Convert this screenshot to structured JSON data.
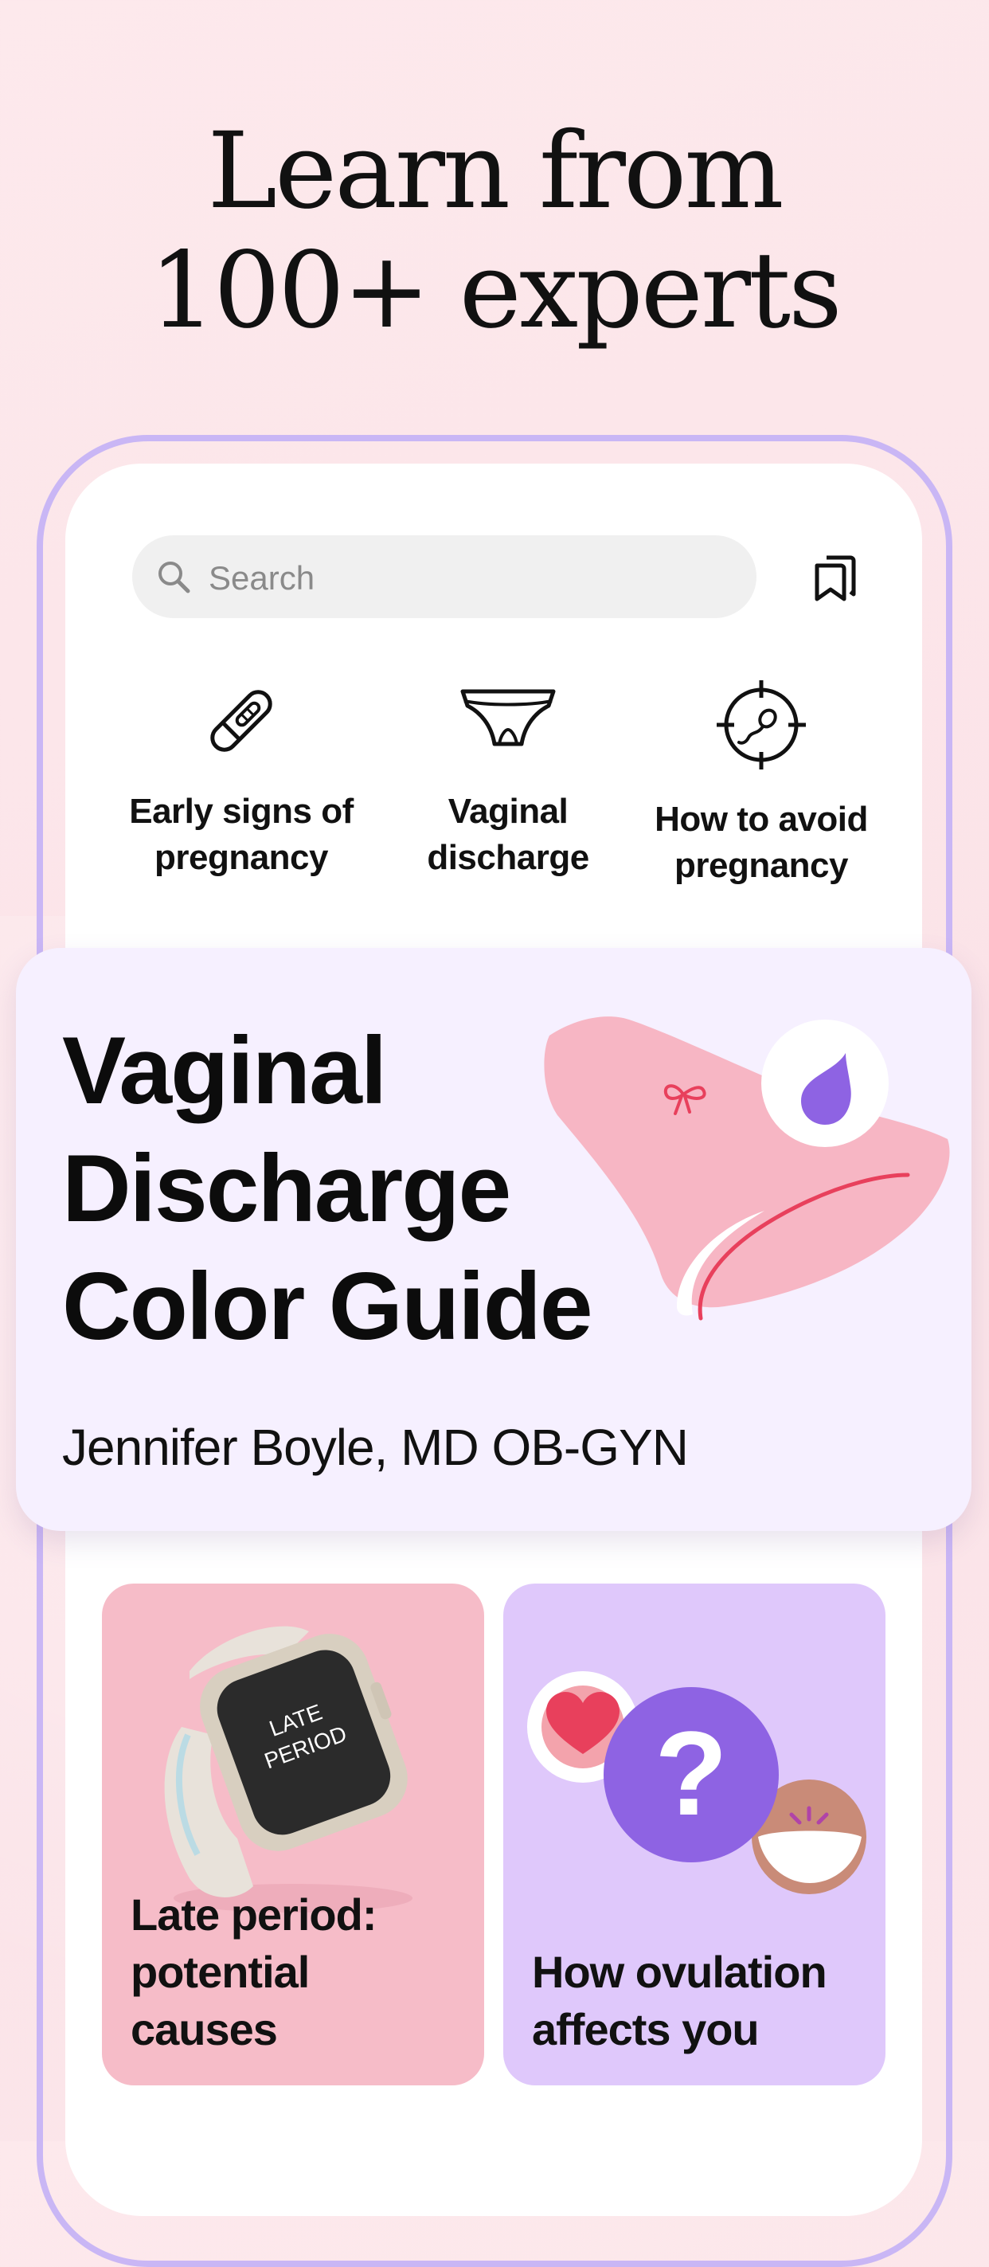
{
  "headline": {
    "line1": "Learn from",
    "line2": "100+ experts"
  },
  "search": {
    "placeholder": "Search",
    "icon": "search-icon"
  },
  "bookmarks": {
    "icon": "bookmarks-icon"
  },
  "quick_topics": [
    {
      "line1": "Early signs of",
      "line2": "pregnancy",
      "icon": "pregnancy-test-icon"
    },
    {
      "line1": "Vaginal",
      "line2": "discharge",
      "icon": "underwear-icon"
    },
    {
      "line1": "How to avoid",
      "line2": "pregnancy",
      "icon": "sperm-target-icon"
    }
  ],
  "featured": {
    "title_lines": [
      "Vaginal",
      "Discharge",
      "Color Guide"
    ],
    "author": "Jennifer Boyle,  MD OB-GYN"
  },
  "watch_screen": {
    "line1": "LATE",
    "line2": "PERIOD"
  },
  "articles": [
    {
      "title_lines": [
        "Late period:",
        "potential",
        "causes"
      ]
    },
    {
      "title_lines": [
        "How ovulation",
        "affects you"
      ]
    }
  ],
  "colors": {
    "background": "#fde9ec",
    "frame_accent": "#c9b6f5",
    "featured_card": "#f6f0ff",
    "card_pink": "#f6bcc8",
    "card_lavender": "#dfc8fb",
    "purple": "#8e63e3",
    "coral": "#e8405c"
  }
}
